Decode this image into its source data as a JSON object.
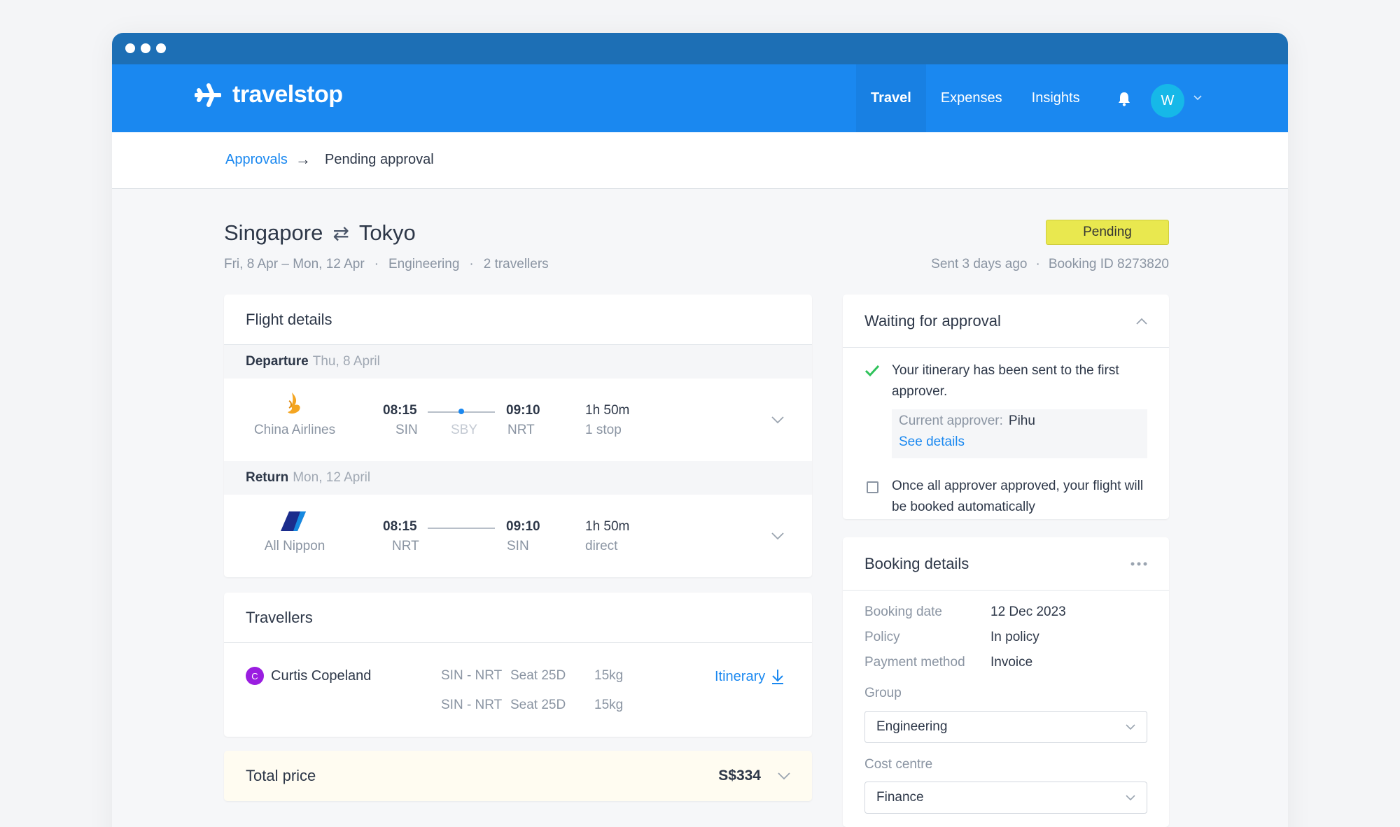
{
  "window": {
    "controls": [
      "close",
      "minimize",
      "maximize"
    ]
  },
  "nav": {
    "logo_text": "travelstop",
    "links": [
      {
        "label": "Travel",
        "active": true
      },
      {
        "label": "Expenses",
        "active": false
      },
      {
        "label": "Insights",
        "active": false
      }
    ],
    "avatar_initial": "W",
    "icons": [
      "plane-icon",
      "bell-icon",
      "chevron-down-icon"
    ]
  },
  "breadcrumb": {
    "parent": "Approvals",
    "separator": "→",
    "current": "Pending approval"
  },
  "trip": {
    "from": "Singapore",
    "swap_symbol": "⇄",
    "to": "Tokyo",
    "dates": "Fri, 8 Apr – Mon, 12 Apr",
    "group": "Engineering",
    "travellers": "2 travellers",
    "status": "Pending",
    "sent": "Sent 3 days ago",
    "booking_id": "Booking ID 8273820"
  },
  "flight_details": {
    "title": "Flight details",
    "departure": {
      "label": "Departure",
      "date": "Thu, 8 April",
      "airline": "China Airlines",
      "dep_time": "08:15",
      "dep_code": "SIN",
      "stop_code": "SBY",
      "arr_time": "09:10",
      "arr_code": "NRT",
      "duration": "1h 50m",
      "stops": "1 stop"
    },
    "return": {
      "label": "Return",
      "date": "Mon, 12 April",
      "airline": "All Nippon",
      "dep_time": "08:15",
      "dep_code": "NRT",
      "arr_time": "09:10",
      "arr_code": "SIN",
      "duration": "1h 50m",
      "stops": "direct"
    }
  },
  "travellers": {
    "title": "Travellers",
    "name": "Curtis Copeland",
    "initial": "C",
    "itinerary_label": "Itinerary",
    "segments": [
      {
        "route": "SIN - NRT",
        "seat": "Seat 25D",
        "baggage": "15kg"
      },
      {
        "route": "SIN - NRT",
        "seat": "Seat 25D",
        "baggage": "15kg"
      }
    ]
  },
  "total": {
    "label": "Total price",
    "value": "S$334"
  },
  "approval": {
    "title": "Waiting for approval",
    "sent_text": "Your itinerary has been sent to the first approver.",
    "approver_label": "Current approver:",
    "approver_name": "Pihu",
    "see_details": "See details",
    "auto_text": "Once all approver approved, your flight will be booked automatically"
  },
  "booking": {
    "title": "Booking details",
    "rows": [
      {
        "key": "Booking date",
        "value": "12 Dec 2023"
      },
      {
        "key": "Policy",
        "value": "In policy"
      },
      {
        "key": "Payment method",
        "value": "Invoice"
      }
    ],
    "group_label": "Group",
    "group_value": "Engineering",
    "cost_label": "Cost centre",
    "cost_value": "Finance"
  },
  "colors": {
    "brand": "#1a88f0",
    "titlebar": "#1d6fb5",
    "pending": "#e9e84f",
    "success": "#2ec25a"
  }
}
